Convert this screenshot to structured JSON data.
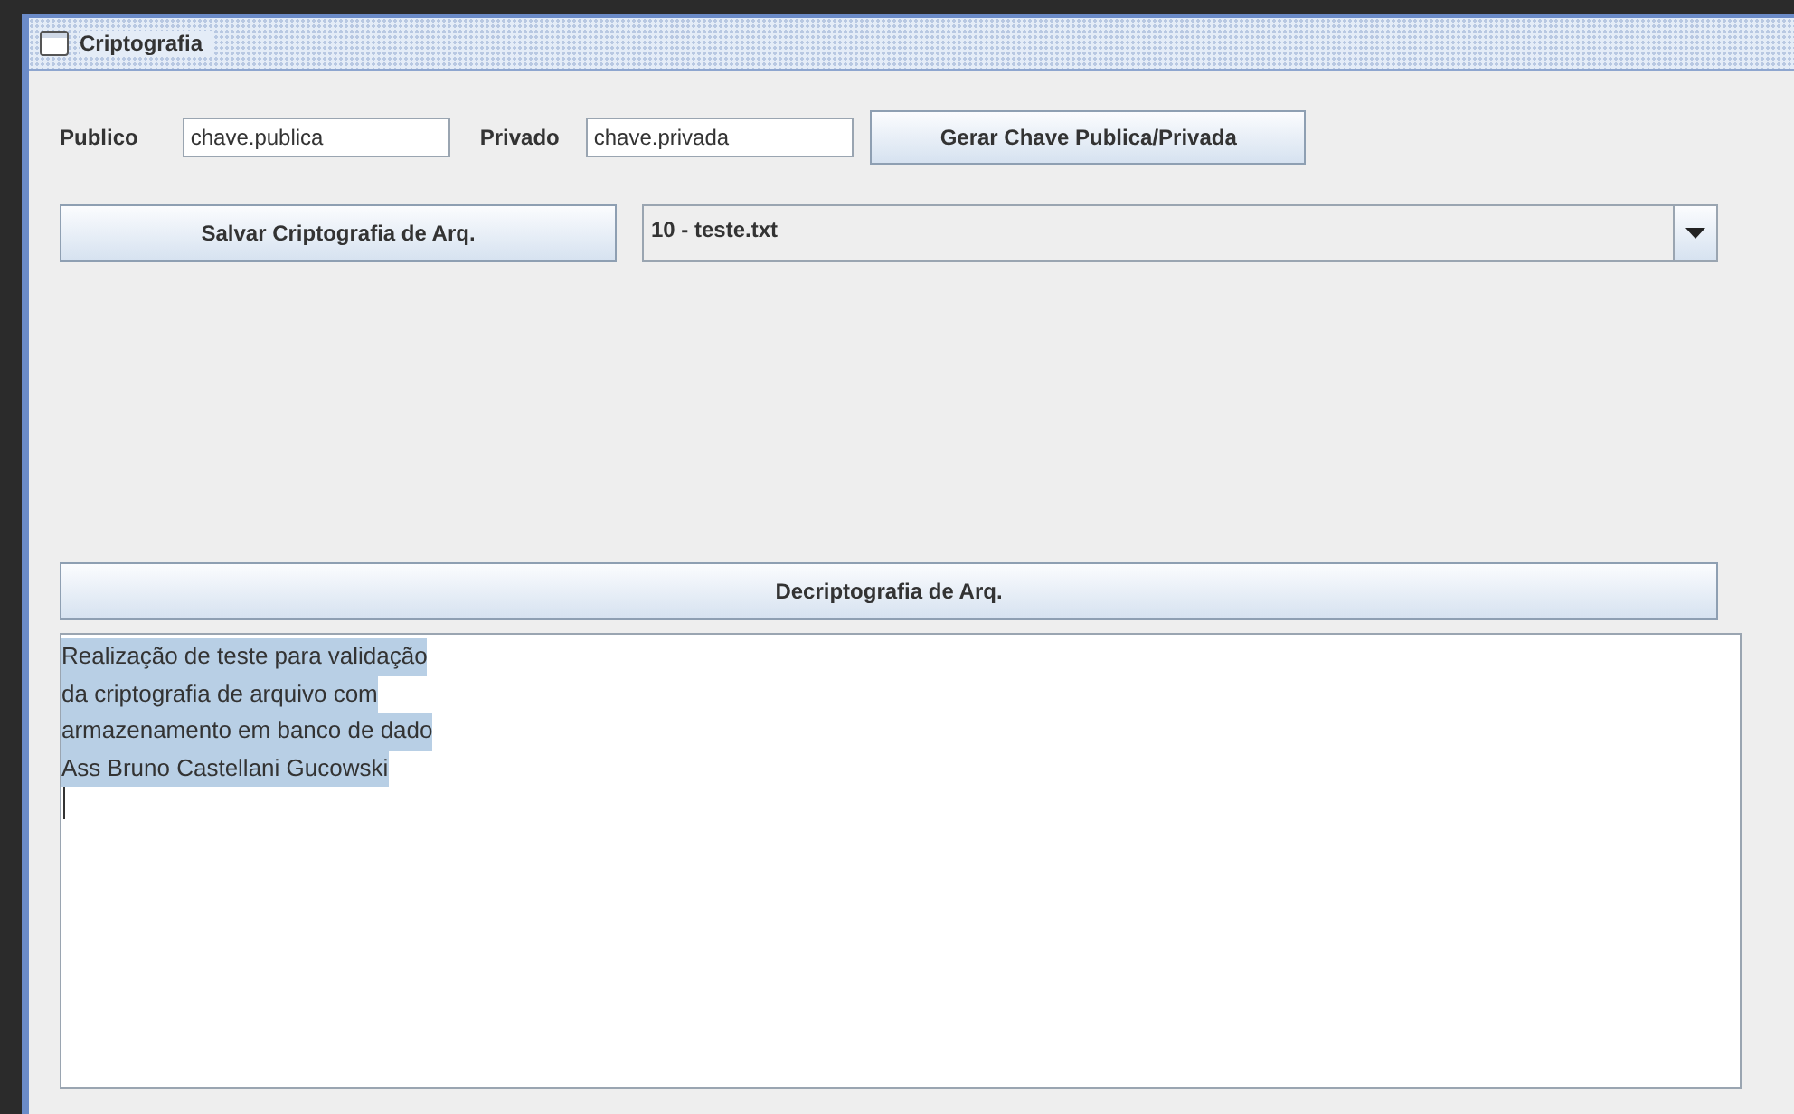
{
  "window": {
    "title": "Criptografia"
  },
  "keys": {
    "public_label": "Publico",
    "public_value": "chave.publica",
    "private_label": "Privado",
    "private_value": "chave.privada",
    "generate_button": "Gerar Chave Publica/Privada"
  },
  "save_button": "Salvar Criptografia de Arq.",
  "file_select": {
    "value": "10 - teste.txt"
  },
  "decrypt_button": "Decriptografia de Arq.",
  "text_area": {
    "lines": [
      {
        "text": "Realização de teste para validação",
        "selected": true
      },
      {
        "text": "da criptografia de arquivo com",
        "selected": true
      },
      {
        "text": "armazenamento em banco de dado",
        "selected": true
      },
      {
        "text": "Ass Bruno Castellani Gucowski",
        "selected": true
      }
    ],
    "caret": true
  }
}
